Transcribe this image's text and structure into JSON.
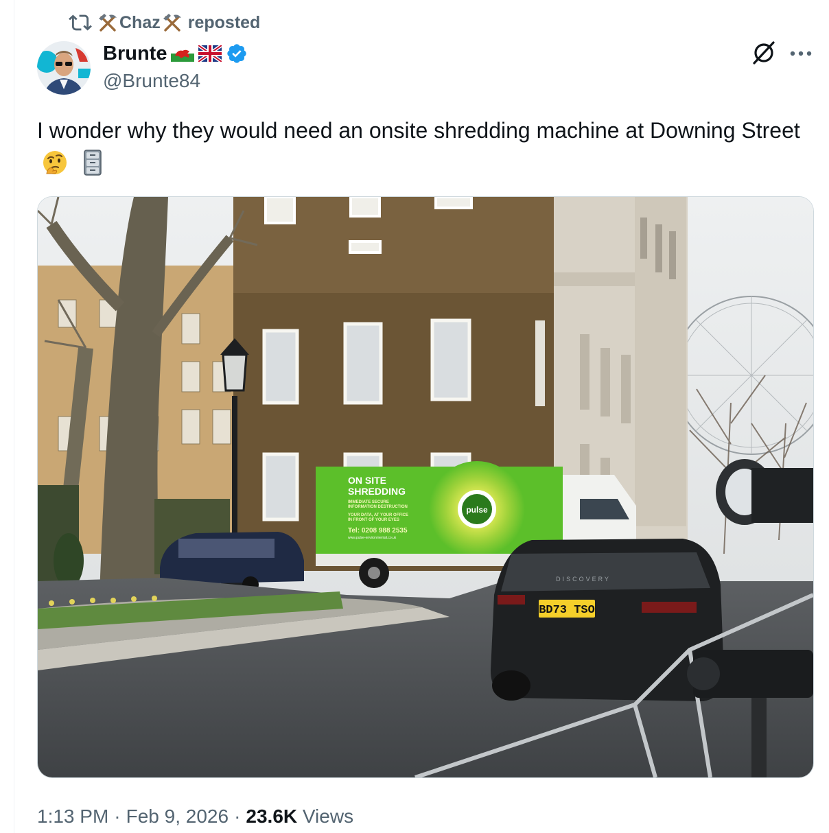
{
  "repost": {
    "icon": "repost-icon",
    "reposter_name": "Chaz",
    "reposter_emoji": "hammer-and-pick",
    "label": "reposted"
  },
  "author": {
    "display_name": "Brunte",
    "handle": "@Brunte84",
    "flags": [
      "wales-flag",
      "uk-flag"
    ],
    "verified": true,
    "verified_color": "#1d9bf0"
  },
  "actions": {
    "grok_icon": "grok-icon",
    "more_icon": "more-icon"
  },
  "tweet": {
    "text": "I wonder why they would need an onsite shredding machine at Downing Street",
    "emojis": [
      "thinking-face-emoji",
      "file-cabinet-emoji"
    ]
  },
  "media": {
    "truck_text": {
      "headline_line1": "ON SITE",
      "headline_line2": "SHREDDING",
      "sub_line1": "IMMEDIATE SECURE",
      "sub_line2": "INFORMATION DESTRUCTION",
      "sub_line3": "YOUR DATA, AT YOUR OFFICE",
      "sub_line4": "IN FRONT OF YOUR EYES",
      "phone": "Tel: 0208 988 2535",
      "website": "www.pulse-environmental.co.uk",
      "brand": "pulse"
    },
    "plate": "BD73 TSO",
    "car_badge": "DISCOVERY"
  },
  "meta": {
    "time": "1:13 PM",
    "separator": "·",
    "date": "Feb 9, 2026",
    "views_count": "23.6K",
    "views_label": "Views"
  },
  "colors": {
    "text_primary": "#0f1419",
    "text_secondary": "#536471",
    "border": "#cfd9de",
    "truck_green": "#5cbf2a"
  }
}
